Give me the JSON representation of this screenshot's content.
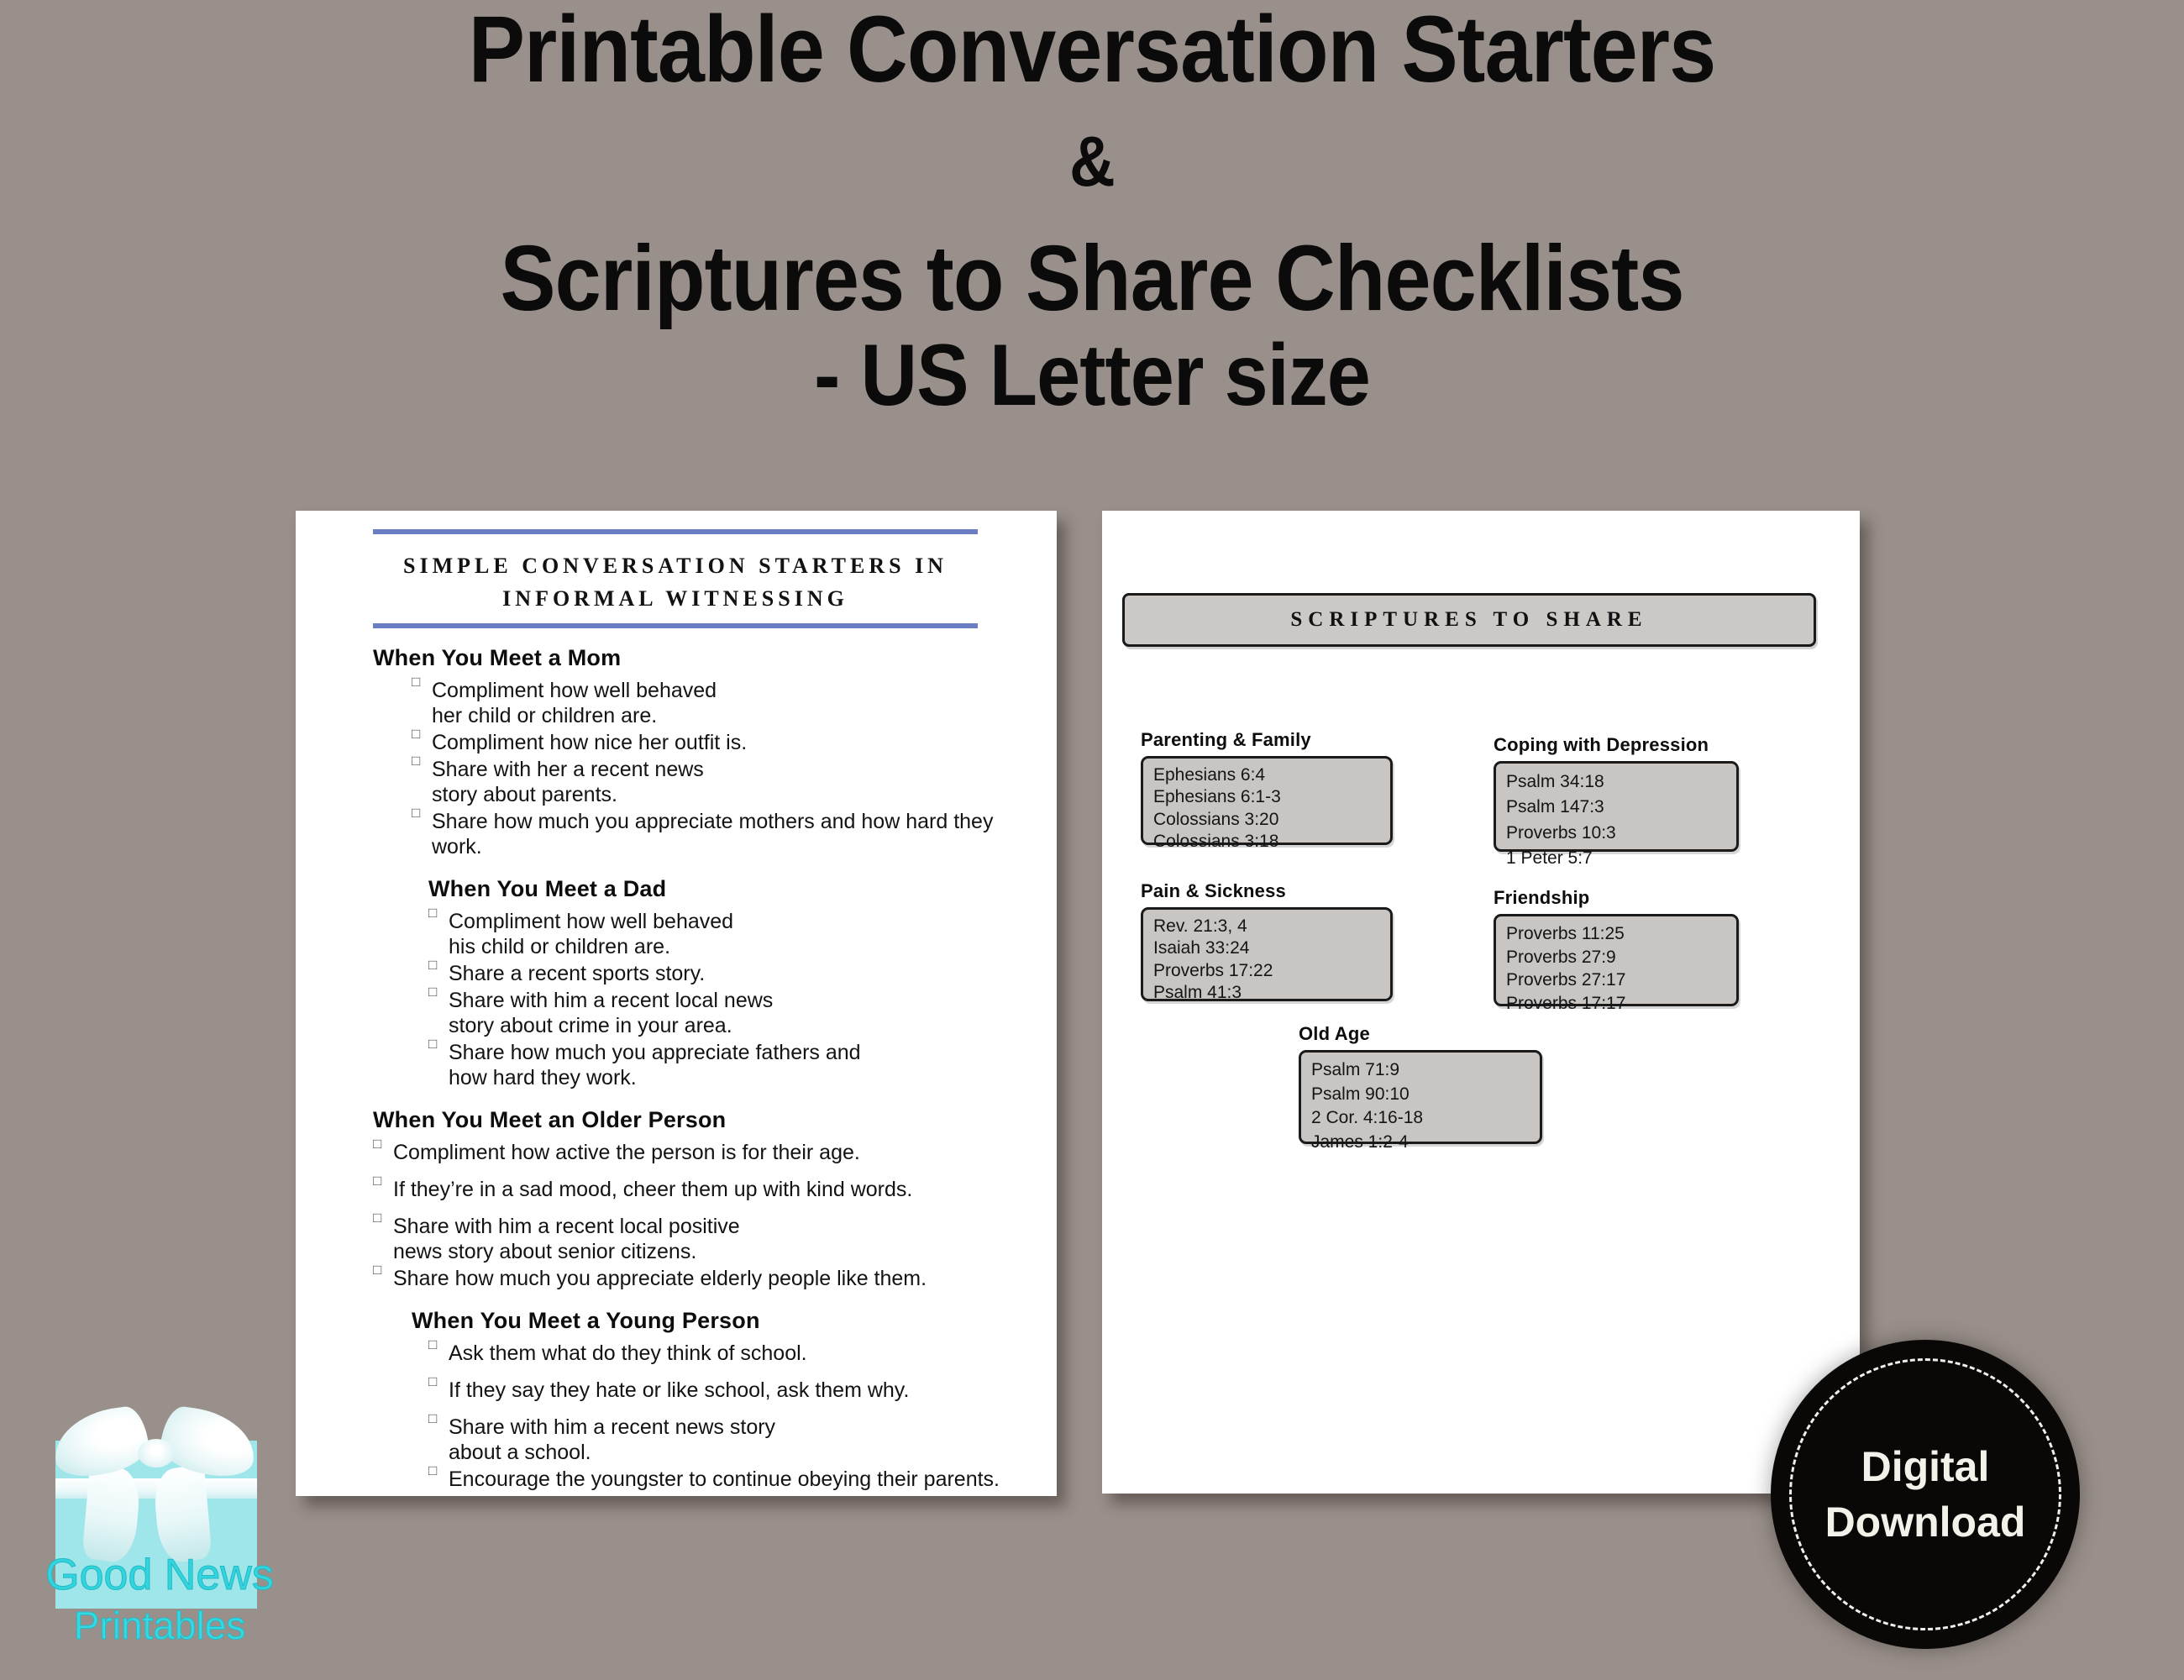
{
  "title": {
    "line1": "Printable Conversation Starters",
    "line2": "&",
    "line3": "Scriptures to Share Checklists",
    "line4": "- US Letter size"
  },
  "left_page": {
    "doc_title_line1": "SIMPLE CONVERSATION STARTERS IN",
    "doc_title_line2": "INFORMAL WITNESSING",
    "checkbox_glyph": "□",
    "sections": [
      {
        "heading": "When You Meet a Mom",
        "items": [
          "Compliment how well behaved\nher child or children are.",
          "Compliment how nice her outfit is.",
          "Share with her a recent news\nstory about parents.",
          "Share how much you appreciate mothers and how hard they work."
        ]
      },
      {
        "heading": "When You Meet a Dad",
        "items": [
          "Compliment how well behaved\nhis child or children are.",
          "Share a recent sports story.",
          "Share with him a recent local news\nstory about crime in your area.",
          "Share how much you appreciate fathers and\nhow hard they work."
        ]
      },
      {
        "heading": "When You Meet an Older Person",
        "items": [
          "Compliment how active the person is for their age.",
          "If they’re in a sad mood, cheer them up with kind words.",
          "Share with him a recent local positive\nnews story about senior citizens.",
          "Share how much you appreciate elderly people like them."
        ]
      },
      {
        "heading": "When You Meet a Young Person",
        "items": [
          "Ask them what do they think of school.",
          "If they say they hate or like school, ask them why.",
          "Share with him a recent news story\nabout a school.",
          "Encourage the youngster to continue obeying their parents."
        ]
      }
    ]
  },
  "right_page": {
    "banner": "SCRIPTURES TO SHARE",
    "categories": [
      {
        "title": "Parenting & Family",
        "verses": [
          "Ephesians 6:4",
          "Ephesians 6:1-3",
          "Colossians 3:20",
          "Colossians 3:18"
        ]
      },
      {
        "title": "Pain & Sickness",
        "verses": [
          "Rev. 21:3, 4",
          "Isaiah 33:24",
          "Proverbs 17:22",
          "Psalm 41:3"
        ]
      },
      {
        "title": "Coping with Depression",
        "verses": [
          "Psalm 34:18",
          "Psalm 147:3",
          "Proverbs 10:3",
          " 1 Peter 5:7"
        ]
      },
      {
        "title": "Friendship",
        "verses": [
          "Proverbs 11:25",
          "Proverbs 27:9",
          "Proverbs 27:17",
          "Proverbs 17:17"
        ]
      },
      {
        "title": "Old Age",
        "verses": [
          " Psalm 71:9",
          "Psalm 90:10",
          "2 Cor. 4:16-18",
          "James 1:2-4"
        ]
      }
    ]
  },
  "logo": {
    "name": "Good News",
    "sub": "Printables"
  },
  "badge": {
    "line1": "Digital",
    "line2": "Download"
  },
  "colors": {
    "background": "#9a908b",
    "accent_rule": "#6b7ec4",
    "box_fill": "#c9c5c3",
    "logo_teal": "#32d4de",
    "badge_bg": "#0a0806"
  }
}
